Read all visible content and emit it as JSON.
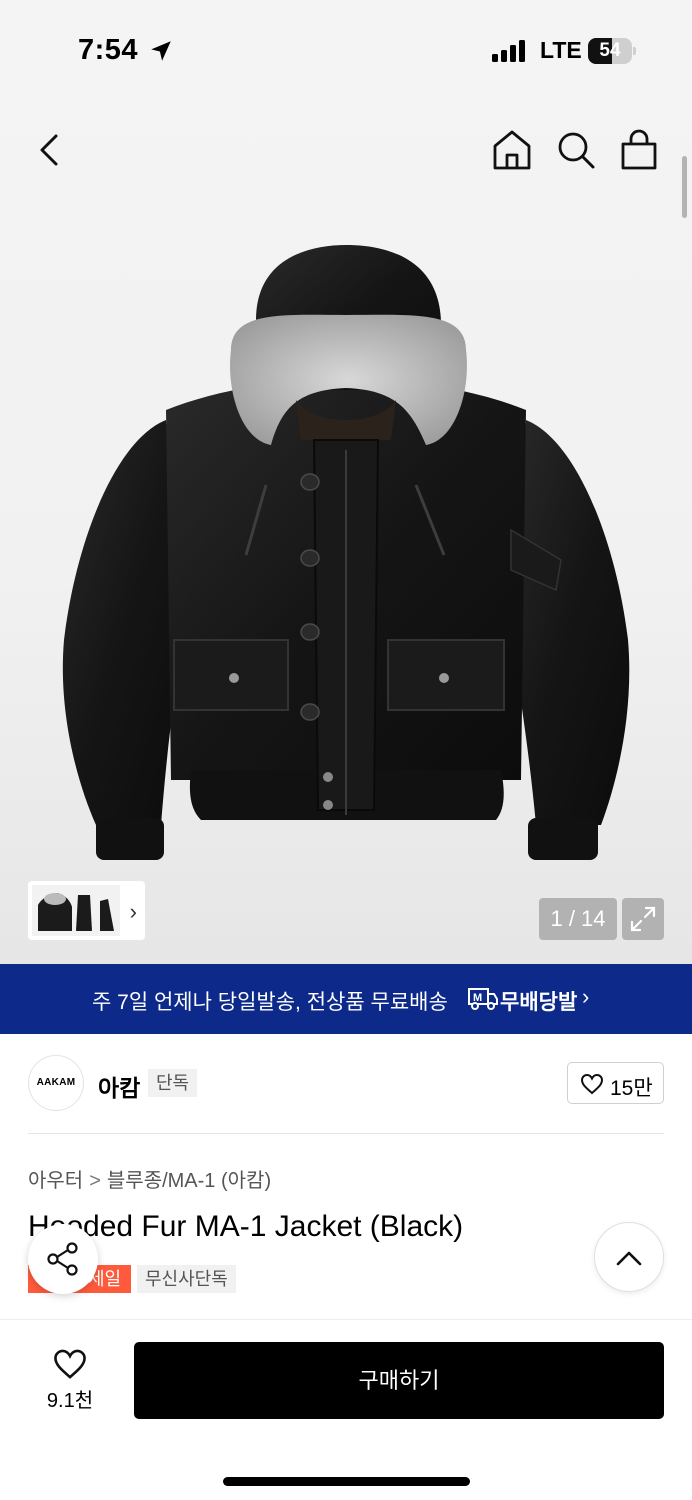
{
  "status_bar": {
    "time": "7:54",
    "network": "LTE",
    "battery": "54",
    "battery_level": 0.54
  },
  "nav": {
    "back_icon": "chevron-left-icon",
    "home_icon": "home-icon",
    "search_icon": "search-icon",
    "cart_icon": "shopping-bag-icon"
  },
  "gallery": {
    "counter": "1 / 14",
    "current": 1,
    "total": 14,
    "expand_icon": "expand-icon",
    "thumbs_chevron": "›"
  },
  "banner": {
    "text": "주 7일 언제나 당일발송, 전상품 무료배송",
    "badge_text": "무배당발",
    "badge_icon": "m-truck-icon",
    "chevron": "›",
    "bg_color": "#0d2a8a"
  },
  "brand": {
    "logo_text": "AAKAM",
    "name": "아캄",
    "tag": "단독",
    "likes": "15만"
  },
  "breadcrumb": {
    "level1": "아우터",
    "separator": ">",
    "level2": "블루종/MA-1 (아캄)"
  },
  "product": {
    "title": "Hooded Fur MA-1 Jacket (Black)",
    "sale_tag": "세일",
    "exclusive_tag": "무신사단독",
    "sale_color": "#ff5a3c"
  },
  "bottom_bar": {
    "wishlist_count": "9.1천",
    "buy_label": "구매하기"
  }
}
